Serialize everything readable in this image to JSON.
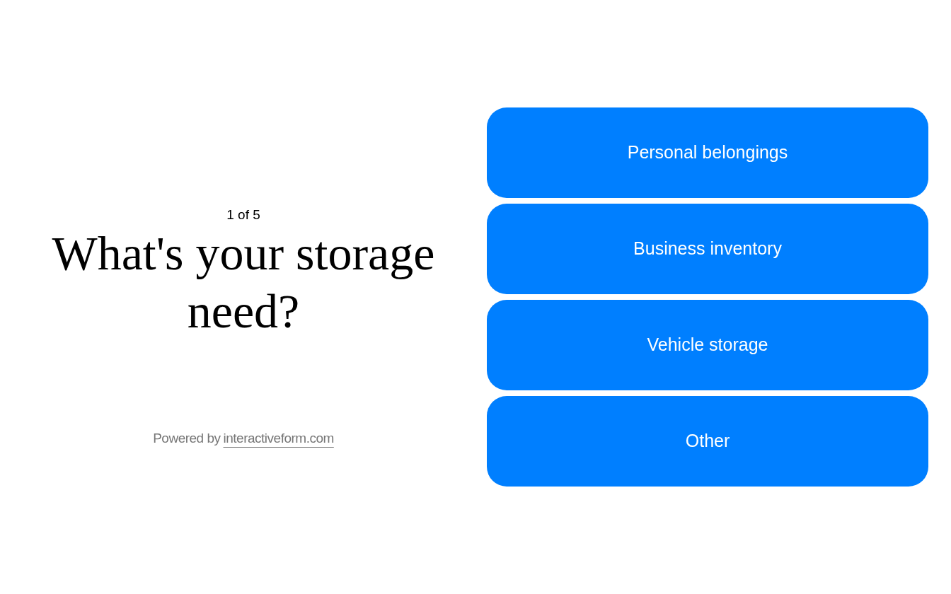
{
  "progress": "1 of 5",
  "question": "What's your storage need?",
  "footer": {
    "prefix": "Powered by",
    "link": "interactiveform.com"
  },
  "options": [
    {
      "label": "Personal belongings"
    },
    {
      "label": "Business inventory"
    },
    {
      "label": "Vehicle storage"
    },
    {
      "label": "Other"
    }
  ]
}
